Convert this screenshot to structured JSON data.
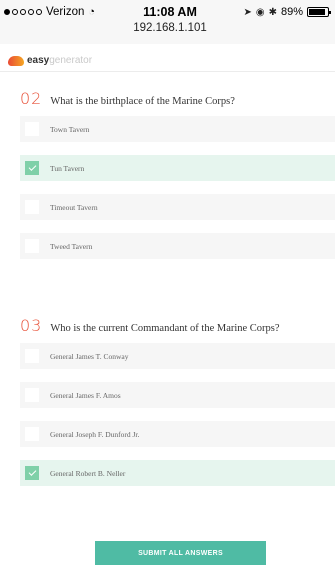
{
  "status_bar": {
    "carrier": "Verizon",
    "time": "11:08 AM",
    "url": "192.168.1.101",
    "battery": "89%",
    "battery_level": 0.89
  },
  "app": {
    "logo_part1": "easy",
    "logo_part2": "generator"
  },
  "questions": [
    {
      "number": "02",
      "text": "What is the birthplace of the Marine Corps?",
      "answers": [
        {
          "label": "Town Tavern",
          "selected": false
        },
        {
          "label": "Tun Tavern",
          "selected": true
        },
        {
          "label": "Timeout Tavern",
          "selected": false
        },
        {
          "label": "Tweed Tavern",
          "selected": false
        }
      ]
    },
    {
      "number": "03",
      "text": "Who is the current Commandant of the Marine Corps?",
      "answers": [
        {
          "label": "General James T. Conway",
          "selected": false
        },
        {
          "label": "General James F. Amos",
          "selected": false
        },
        {
          "label": "General Joseph F. Dunford Jr.",
          "selected": false
        },
        {
          "label": "General Robert B. Neller",
          "selected": true
        }
      ]
    }
  ],
  "submit_label": "SUBMIT ALL ANSWERS"
}
